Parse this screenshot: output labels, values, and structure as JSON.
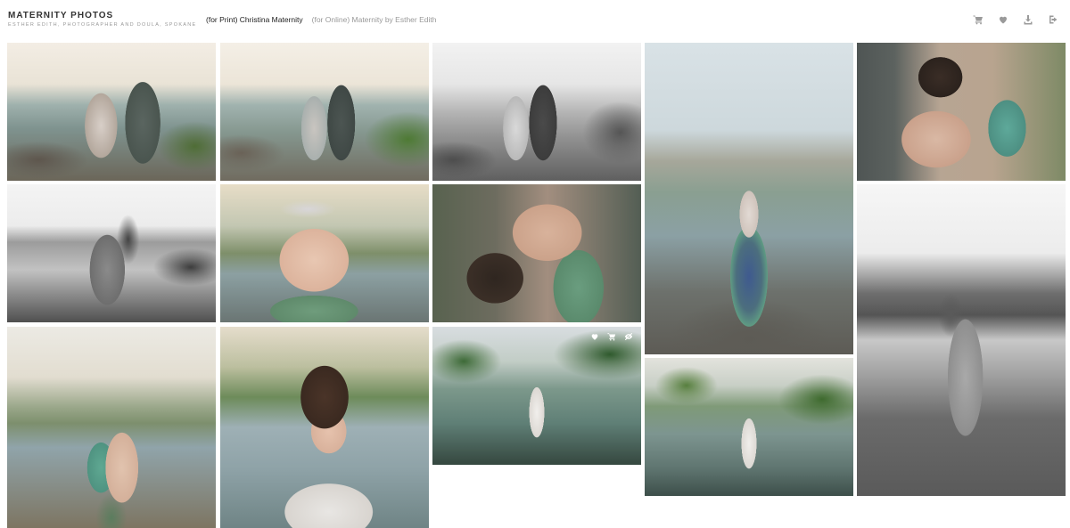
{
  "header": {
    "title": "MATERNITY PHOTOS",
    "subtitle": "ESTHER EDITH, PHOTOGRAPHER AND DOULA, SPOKANE",
    "tabs": [
      {
        "label": "(for Print) Christina Maternity",
        "active": true
      },
      {
        "label": "(for Online) Maternity by Esther Edith",
        "active": false
      }
    ],
    "actions": [
      "cart-icon",
      "heart-icon",
      "download-icon",
      "share-icon"
    ]
  },
  "gallery": {
    "photos": [
      {
        "name": "photo-family-embrace-river",
        "tone": "color"
      },
      {
        "name": "photo-family-forehead-kiss",
        "tone": "color"
      },
      {
        "name": "photo-family-bw-riverbank",
        "tone": "bw"
      },
      {
        "name": "photo-mother-standing-river-blue-skirt",
        "tone": "color"
      },
      {
        "name": "photo-child-hugging-mother-closeup",
        "tone": "color"
      },
      {
        "name": "photo-family-bw-hug-river",
        "tone": "bw"
      },
      {
        "name": "photo-belly-closeup-hands",
        "tone": "color"
      },
      {
        "name": "photo-child-kissing-belly",
        "tone": "color"
      },
      {
        "name": "photo-bw-mother-child-tall",
        "tone": "bw"
      },
      {
        "name": "photo-mother-holding-child-river",
        "tone": "color"
      },
      {
        "name": "photo-mother-portrait-white-dress",
        "tone": "color"
      },
      {
        "name": "photo-mother-wading-water-trees",
        "tone": "color",
        "hovered": true
      },
      {
        "name": "photo-mother-standing-water-wide",
        "tone": "color"
      }
    ],
    "overlay_actions": [
      "heart-icon",
      "cart-icon",
      "hide-icon"
    ]
  }
}
